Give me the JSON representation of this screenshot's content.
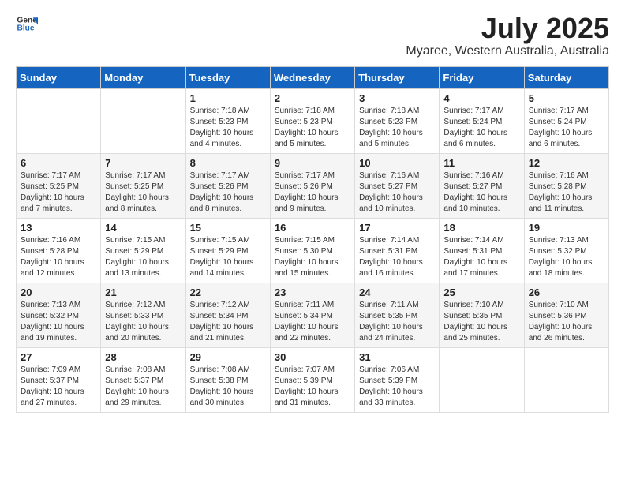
{
  "header": {
    "logo_general": "General",
    "logo_blue": "Blue",
    "month_year": "July 2025",
    "location": "Myaree, Western Australia, Australia"
  },
  "weekdays": [
    "Sunday",
    "Monday",
    "Tuesday",
    "Wednesday",
    "Thursday",
    "Friday",
    "Saturday"
  ],
  "weeks": [
    [
      {
        "day": "",
        "sunrise": "",
        "sunset": "",
        "daylight": ""
      },
      {
        "day": "",
        "sunrise": "",
        "sunset": "",
        "daylight": ""
      },
      {
        "day": "1",
        "sunrise": "Sunrise: 7:18 AM",
        "sunset": "Sunset: 5:23 PM",
        "daylight": "Daylight: 10 hours and 4 minutes."
      },
      {
        "day": "2",
        "sunrise": "Sunrise: 7:18 AM",
        "sunset": "Sunset: 5:23 PM",
        "daylight": "Daylight: 10 hours and 5 minutes."
      },
      {
        "day": "3",
        "sunrise": "Sunrise: 7:18 AM",
        "sunset": "Sunset: 5:23 PM",
        "daylight": "Daylight: 10 hours and 5 minutes."
      },
      {
        "day": "4",
        "sunrise": "Sunrise: 7:17 AM",
        "sunset": "Sunset: 5:24 PM",
        "daylight": "Daylight: 10 hours and 6 minutes."
      },
      {
        "day": "5",
        "sunrise": "Sunrise: 7:17 AM",
        "sunset": "Sunset: 5:24 PM",
        "daylight": "Daylight: 10 hours and 6 minutes."
      }
    ],
    [
      {
        "day": "6",
        "sunrise": "Sunrise: 7:17 AM",
        "sunset": "Sunset: 5:25 PM",
        "daylight": "Daylight: 10 hours and 7 minutes."
      },
      {
        "day": "7",
        "sunrise": "Sunrise: 7:17 AM",
        "sunset": "Sunset: 5:25 PM",
        "daylight": "Daylight: 10 hours and 8 minutes."
      },
      {
        "day": "8",
        "sunrise": "Sunrise: 7:17 AM",
        "sunset": "Sunset: 5:26 PM",
        "daylight": "Daylight: 10 hours and 8 minutes."
      },
      {
        "day": "9",
        "sunrise": "Sunrise: 7:17 AM",
        "sunset": "Sunset: 5:26 PM",
        "daylight": "Daylight: 10 hours and 9 minutes."
      },
      {
        "day": "10",
        "sunrise": "Sunrise: 7:16 AM",
        "sunset": "Sunset: 5:27 PM",
        "daylight": "Daylight: 10 hours and 10 minutes."
      },
      {
        "day": "11",
        "sunrise": "Sunrise: 7:16 AM",
        "sunset": "Sunset: 5:27 PM",
        "daylight": "Daylight: 10 hours and 10 minutes."
      },
      {
        "day": "12",
        "sunrise": "Sunrise: 7:16 AM",
        "sunset": "Sunset: 5:28 PM",
        "daylight": "Daylight: 10 hours and 11 minutes."
      }
    ],
    [
      {
        "day": "13",
        "sunrise": "Sunrise: 7:16 AM",
        "sunset": "Sunset: 5:28 PM",
        "daylight": "Daylight: 10 hours and 12 minutes."
      },
      {
        "day": "14",
        "sunrise": "Sunrise: 7:15 AM",
        "sunset": "Sunset: 5:29 PM",
        "daylight": "Daylight: 10 hours and 13 minutes."
      },
      {
        "day": "15",
        "sunrise": "Sunrise: 7:15 AM",
        "sunset": "Sunset: 5:29 PM",
        "daylight": "Daylight: 10 hours and 14 minutes."
      },
      {
        "day": "16",
        "sunrise": "Sunrise: 7:15 AM",
        "sunset": "Sunset: 5:30 PM",
        "daylight": "Daylight: 10 hours and 15 minutes."
      },
      {
        "day": "17",
        "sunrise": "Sunrise: 7:14 AM",
        "sunset": "Sunset: 5:31 PM",
        "daylight": "Daylight: 10 hours and 16 minutes."
      },
      {
        "day": "18",
        "sunrise": "Sunrise: 7:14 AM",
        "sunset": "Sunset: 5:31 PM",
        "daylight": "Daylight: 10 hours and 17 minutes."
      },
      {
        "day": "19",
        "sunrise": "Sunrise: 7:13 AM",
        "sunset": "Sunset: 5:32 PM",
        "daylight": "Daylight: 10 hours and 18 minutes."
      }
    ],
    [
      {
        "day": "20",
        "sunrise": "Sunrise: 7:13 AM",
        "sunset": "Sunset: 5:32 PM",
        "daylight": "Daylight: 10 hours and 19 minutes."
      },
      {
        "day": "21",
        "sunrise": "Sunrise: 7:12 AM",
        "sunset": "Sunset: 5:33 PM",
        "daylight": "Daylight: 10 hours and 20 minutes."
      },
      {
        "day": "22",
        "sunrise": "Sunrise: 7:12 AM",
        "sunset": "Sunset: 5:34 PM",
        "daylight": "Daylight: 10 hours and 21 minutes."
      },
      {
        "day": "23",
        "sunrise": "Sunrise: 7:11 AM",
        "sunset": "Sunset: 5:34 PM",
        "daylight": "Daylight: 10 hours and 22 minutes."
      },
      {
        "day": "24",
        "sunrise": "Sunrise: 7:11 AM",
        "sunset": "Sunset: 5:35 PM",
        "daylight": "Daylight: 10 hours and 24 minutes."
      },
      {
        "day": "25",
        "sunrise": "Sunrise: 7:10 AM",
        "sunset": "Sunset: 5:35 PM",
        "daylight": "Daylight: 10 hours and 25 minutes."
      },
      {
        "day": "26",
        "sunrise": "Sunrise: 7:10 AM",
        "sunset": "Sunset: 5:36 PM",
        "daylight": "Daylight: 10 hours and 26 minutes."
      }
    ],
    [
      {
        "day": "27",
        "sunrise": "Sunrise: 7:09 AM",
        "sunset": "Sunset: 5:37 PM",
        "daylight": "Daylight: 10 hours and 27 minutes."
      },
      {
        "day": "28",
        "sunrise": "Sunrise: 7:08 AM",
        "sunset": "Sunset: 5:37 PM",
        "daylight": "Daylight: 10 hours and 29 minutes."
      },
      {
        "day": "29",
        "sunrise": "Sunrise: 7:08 AM",
        "sunset": "Sunset: 5:38 PM",
        "daylight": "Daylight: 10 hours and 30 minutes."
      },
      {
        "day": "30",
        "sunrise": "Sunrise: 7:07 AM",
        "sunset": "Sunset: 5:39 PM",
        "daylight": "Daylight: 10 hours and 31 minutes."
      },
      {
        "day": "31",
        "sunrise": "Sunrise: 7:06 AM",
        "sunset": "Sunset: 5:39 PM",
        "daylight": "Daylight: 10 hours and 33 minutes."
      },
      {
        "day": "",
        "sunrise": "",
        "sunset": "",
        "daylight": ""
      },
      {
        "day": "",
        "sunrise": "",
        "sunset": "",
        "daylight": ""
      }
    ]
  ]
}
